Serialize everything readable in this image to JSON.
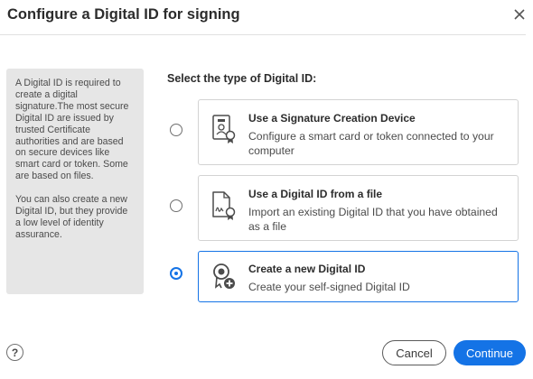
{
  "dialog": {
    "title": "Configure a Digital ID for signing",
    "close_icon": "close-icon"
  },
  "info_panel": {
    "paragraph_1": "A Digital ID is required to create a digital signature.The most secure Digital ID are issued by trusted Certificate authorities and are based on secure devices like smart card or token. Some are based on files.",
    "paragraph_2": "You can also create a new Digital ID, but they provide a low level of identity assurance."
  },
  "main": {
    "select_label": "Select the type of Digital ID:",
    "options": [
      {
        "title": "Use a Signature Creation Device",
        "description": "Configure a smart card or token connected to your computer",
        "icon": "signature-device-icon",
        "selected": false
      },
      {
        "title": "Use a Digital ID from a file",
        "description": "Import an existing Digital ID that you have obtained as a file",
        "icon": "digital-id-file-icon",
        "selected": false
      },
      {
        "title": "Create a new Digital ID",
        "description": "Create your self-signed Digital ID",
        "icon": "create-digital-id-icon",
        "selected": true
      }
    ]
  },
  "footer": {
    "help_label": "?",
    "cancel_label": "Cancel",
    "continue_label": "Continue"
  },
  "colors": {
    "accent": "#1473e6",
    "panel_bg": "#e6e6e6",
    "text": "#2c2c2c"
  }
}
